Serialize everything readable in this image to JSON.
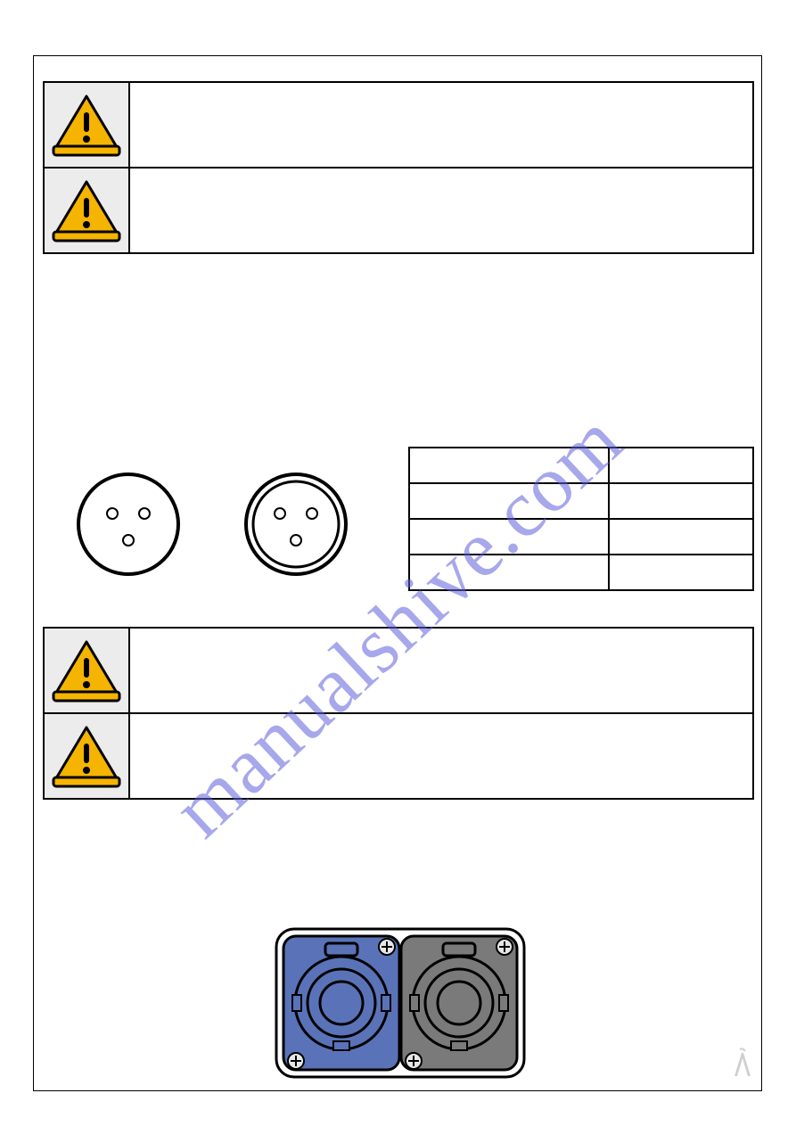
{
  "watermark": "manualshive.com",
  "warning_block_1": {
    "row1_text": "",
    "row2_text": ""
  },
  "warning_block_2": {
    "row1_text": "",
    "row2_text": ""
  },
  "xlr": {
    "left_label": "",
    "right_label": ""
  },
  "pin_table": {
    "rows": [
      {
        "c1": "",
        "c2": ""
      },
      {
        "c1": "",
        "c2": ""
      },
      {
        "c1": "",
        "c2": ""
      },
      {
        "c1": "",
        "c2": ""
      }
    ]
  },
  "powercon": {
    "label": ""
  }
}
